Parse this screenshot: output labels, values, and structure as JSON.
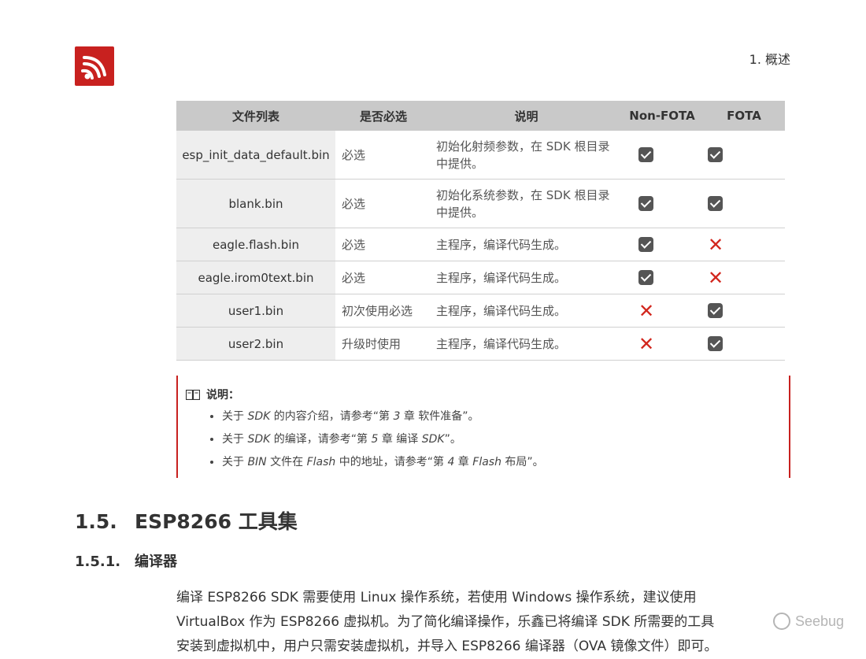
{
  "header": {
    "logo_name": "espressif-logo",
    "section": "1. 概述"
  },
  "table": {
    "headers": [
      "文件列表",
      "是否必选",
      "说明",
      "Non-FOTA",
      "FOTA"
    ],
    "rows": [
      {
        "name": "esp_init_data_default.bin",
        "required": "必选",
        "desc": "初始化射频参数，在 SDK 根目录中提供。",
        "nonfota": "check",
        "fota": "check"
      },
      {
        "name": "blank.bin",
        "required": "必选",
        "desc": "初始化系统参数，在 SDK 根目录中提供。",
        "nonfota": "check",
        "fota": "check"
      },
      {
        "name": "eagle.flash.bin",
        "required": "必选",
        "desc": "主程序，编译代码生成。",
        "nonfota": "check",
        "fota": "cross"
      },
      {
        "name": "eagle.irom0text.bin",
        "required": "必选",
        "desc": "主程序，编译代码生成。",
        "nonfota": "check",
        "fota": "cross"
      },
      {
        "name": "user1.bin",
        "required": "初次使用必选",
        "desc": "主程序，编译代码生成。",
        "nonfota": "cross",
        "fota": "check"
      },
      {
        "name": "user2.bin",
        "required": "升级时使用",
        "desc": "主程序，编译代码生成。",
        "nonfota": "cross",
        "fota": "check"
      }
    ]
  },
  "note": {
    "title": "说明：",
    "items": [
      {
        "pre": "关于 ",
        "it": "SDK",
        "post": " 的内容介绍，请参考“第 ",
        "it2": "3",
        "post2": " 章 软件准备”。"
      },
      {
        "pre": "关于 ",
        "it": "SDK",
        "post": " 的编译，请参考“第 ",
        "it2": "5",
        "post2": " 章 编译 ",
        "it3": "SDK",
        "post3": "”。"
      },
      {
        "pre": "关于 ",
        "it": "BIN",
        "post": " 文件在 ",
        "it2": "Flash",
        "post2": " 中的地址，请参考“第 ",
        "it3": "4",
        "post3": " 章 ",
        "it4": "Flash",
        "post4": " 布局”。"
      }
    ]
  },
  "section": {
    "number": "1.5.",
    "title": "ESP8266 工具集"
  },
  "subsection": {
    "number": "1.5.1.",
    "title": "编译器"
  },
  "paragraph": {
    "line1": "编译 ESP8266 SDK 需要使用 Linux 操作系统，若使用 Windows 操作系统，建议使用",
    "line2": "VirtualBox 作为 ESP8266 虚拟机。为了简化编译操作，乐鑫已将编译 SDK 所需要的工具",
    "line3": "安装到虚拟机中，用户只需安装虚拟机，并导入 ESP8266 编译器（OVA 镜像文件）即可。"
  },
  "watermark": {
    "text": "Seebug"
  },
  "colors": {
    "brand_red": "#c8211f",
    "cross_red": "#d2261d",
    "header_gray": "#c9c9c9",
    "name_cell": "#eeeeee"
  }
}
